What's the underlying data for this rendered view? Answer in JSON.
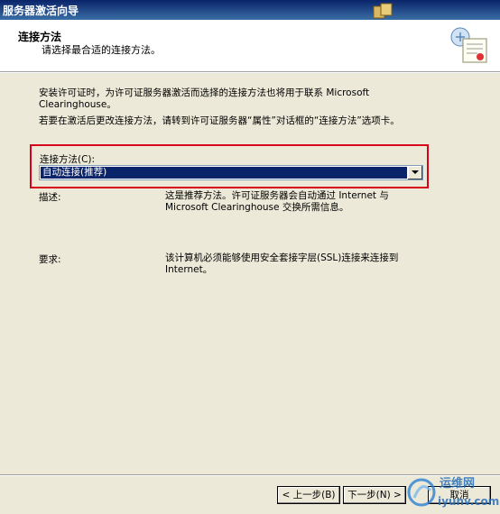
{
  "window": {
    "title": "服务器激活向导",
    "title_icon": "activation-wizard-icon"
  },
  "header": {
    "title": "连接方法",
    "subtitle": "请选择最合适的连接方法。",
    "icon": "license-certificate-icon"
  },
  "body": {
    "paragraph1": "安装许可证时，为许可证服务器激活而选择的连接方法也将用于联系 Microsoft Clearinghouse。",
    "paragraph2": "若要在激活后更改连接方法，请转到许可证服务器“属性”对话框的“连接方法”选项卡。",
    "combo_label": "连接方法(C):",
    "combo_value": "自动连接(推荐)",
    "description_label": "描述:",
    "description_text": "这是推荐方法。许可证服务器会自动通过 Internet 与 Microsoft Clearinghouse 交换所需信息。",
    "requirement_label": "要求:",
    "requirement_text": "该计算机必须能够使用安全套接字层(SSL)连接来连接到 Internet。"
  },
  "buttons": {
    "back": "< 上一步(B)",
    "next": "下一步(N) >",
    "cancel": "取消"
  },
  "colors": {
    "title_bar": "#0a246a",
    "selection": "#0a246a",
    "highlight_border": "#d9001b",
    "dialog_bg": "#ece9d8"
  },
  "watermark": {
    "text_cn": "运维网",
    "text_domain": "iyunv.com"
  }
}
